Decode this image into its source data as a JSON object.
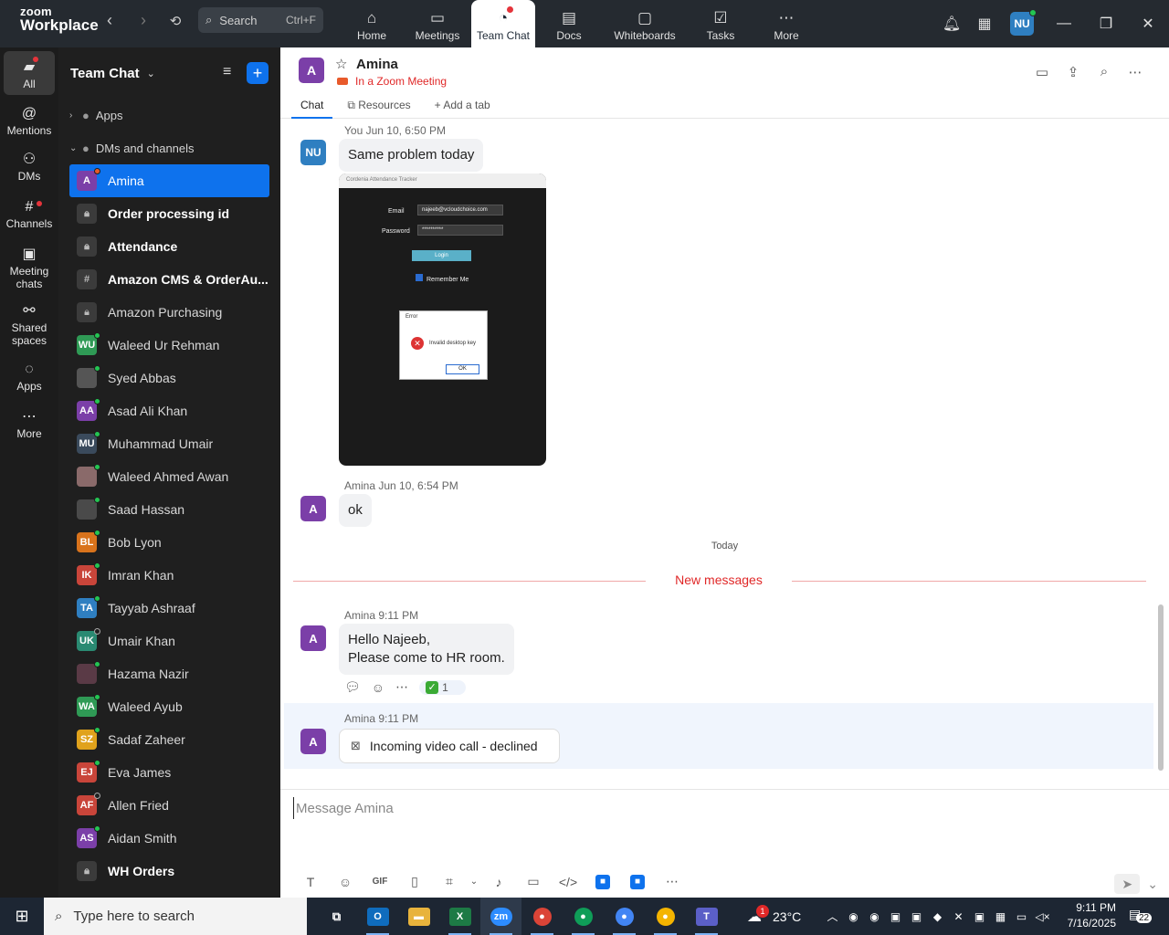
{
  "app": {
    "logo_line1": "zoom",
    "logo_line2": "Workplace",
    "search_placeholder": "Search",
    "search_shortcut": "Ctrl+F",
    "profile_initials": "NU",
    "accent_color": "#0e72ed"
  },
  "top_tabs": [
    {
      "label": "Home",
      "icon": "home-icon"
    },
    {
      "label": "Meetings",
      "icon": "video-camera-icon"
    },
    {
      "label": "Team Chat",
      "icon": "chat-bubble-icon",
      "active": true,
      "badge": true
    },
    {
      "label": "Docs",
      "icon": "document-icon"
    },
    {
      "label": "Whiteboards",
      "icon": "whiteboard-icon"
    },
    {
      "label": "Tasks",
      "icon": "tasks-icon"
    },
    {
      "label": "More",
      "icon": "more-dots-icon"
    }
  ],
  "rail": [
    {
      "label": "All",
      "active": true
    },
    {
      "label": "Mentions"
    },
    {
      "label": "DMs"
    },
    {
      "label": "Channels"
    },
    {
      "label": "Meeting chats"
    },
    {
      "label": "Shared spaces"
    },
    {
      "label": "Apps"
    },
    {
      "label": "More"
    }
  ],
  "sidebar": {
    "title": "Team Chat",
    "section_apps": "Apps",
    "section_dms": "DMs and channels",
    "items": [
      {
        "label": "Amina",
        "type": "avatar",
        "initials": "A",
        "color": "#7b3fa8",
        "selected": true,
        "status": "busy"
      },
      {
        "label": "Order processing id",
        "type": "lock",
        "bold": true
      },
      {
        "label": "Attendance",
        "type": "lock",
        "bold": true
      },
      {
        "label": "Amazon CMS & OrderAu...",
        "type": "hash",
        "bold": true
      },
      {
        "label": "Amazon Purchasing",
        "type": "lock"
      },
      {
        "label": "Waleed Ur Rehman",
        "type": "avatar",
        "initials": "WU",
        "color": "#2f9a55",
        "status": "online"
      },
      {
        "label": "Syed Abbas",
        "type": "avatar",
        "initials": "",
        "color": "#555555",
        "status": "online"
      },
      {
        "label": "Asad Ali Khan",
        "type": "avatar",
        "initials": "AA",
        "color": "#7b3fa8",
        "status": "online"
      },
      {
        "label": "Muhammad Umair",
        "type": "avatar",
        "initials": "MU",
        "color": "#3a4a5c",
        "status": "online"
      },
      {
        "label": "Waleed Ahmed Awan",
        "type": "avatar",
        "initials": "",
        "color": "#8a6a6a",
        "status": "online"
      },
      {
        "label": "Saad Hassan",
        "type": "avatar",
        "initials": "",
        "color": "#4a4a4a",
        "status": "online"
      },
      {
        "label": "Bob Lyon",
        "type": "avatar",
        "initials": "BL",
        "color": "#d9731c",
        "status": "online"
      },
      {
        "label": "Imran Khan",
        "type": "avatar",
        "initials": "IK",
        "color": "#c9453a",
        "status": "online"
      },
      {
        "label": "Tayyab Ashraaf",
        "type": "avatar",
        "initials": "TA",
        "color": "#2f7fc1",
        "status": "online"
      },
      {
        "label": "Umair Khan",
        "type": "avatar",
        "initials": "UK",
        "color": "#2a8a72",
        "status": "away"
      },
      {
        "label": "Hazama Nazir",
        "type": "avatar",
        "initials": "",
        "color": "#5a3a46",
        "status": "online"
      },
      {
        "label": "Waleed Ayub",
        "type": "avatar",
        "initials": "WA",
        "color": "#2f9a55",
        "status": "online"
      },
      {
        "label": "Sadaf Zaheer",
        "type": "avatar",
        "initials": "SZ",
        "color": "#e0a21c",
        "status": "online"
      },
      {
        "label": "Eva James",
        "type": "avatar",
        "initials": "EJ",
        "color": "#c9453a",
        "status": "online"
      },
      {
        "label": "Allen Fried",
        "type": "avatar",
        "initials": "AF",
        "color": "#c9453a",
        "status": "away"
      },
      {
        "label": "Aidan Smith",
        "type": "avatar",
        "initials": "AS",
        "color": "#7b3fa8",
        "status": "online"
      },
      {
        "label": "WH Orders",
        "type": "lock",
        "bold": true
      }
    ]
  },
  "chat": {
    "contact_name": "Amina",
    "contact_initials": "A",
    "status": "In a Zoom Meeting",
    "tabs": [
      "Chat",
      "Resources",
      "Add a tab"
    ],
    "messages": {
      "m1_sender": "You",
      "m1_time": "Jun 10, 6:50 PM",
      "m1_initials": "NU",
      "m1_text": "Same problem today",
      "shot_title": "Cordenia Attendance Tracker",
      "shot_email_label": "Email",
      "shot_email_value": "najeeb@vcloudchoice.com",
      "shot_password_label": "Password",
      "shot_password_value": "**********",
      "shot_login": "Login",
      "shot_remember": "Remember Me",
      "shot_error_title": "Error",
      "shot_error_text": "Invalid desktop key",
      "shot_ok": "OK",
      "m2_sender": "Amina",
      "m2_time": "Jun 10, 6:54 PM",
      "m2_text": "ok",
      "today_label": "Today",
      "new_messages_label": "New messages",
      "m3_sender": "Amina",
      "m3_time": "9:11 PM",
      "m3_line1": "Hello Najeeb,",
      "m3_line2": "Please come to HR room.",
      "m3_reaction_count": "1",
      "m4_sender": "Amina",
      "m4_time": "9:11 PM",
      "m4_text": "Incoming video call - declined"
    },
    "composer_placeholder": "Message Amina",
    "composer_gif": "GIF"
  },
  "taskbar": {
    "search_placeholder": "Type here to search",
    "temperature": "23°C",
    "weather_badge": "1",
    "time": "9:11 PM",
    "date": "7/16/2025",
    "notification_count": "22"
  }
}
